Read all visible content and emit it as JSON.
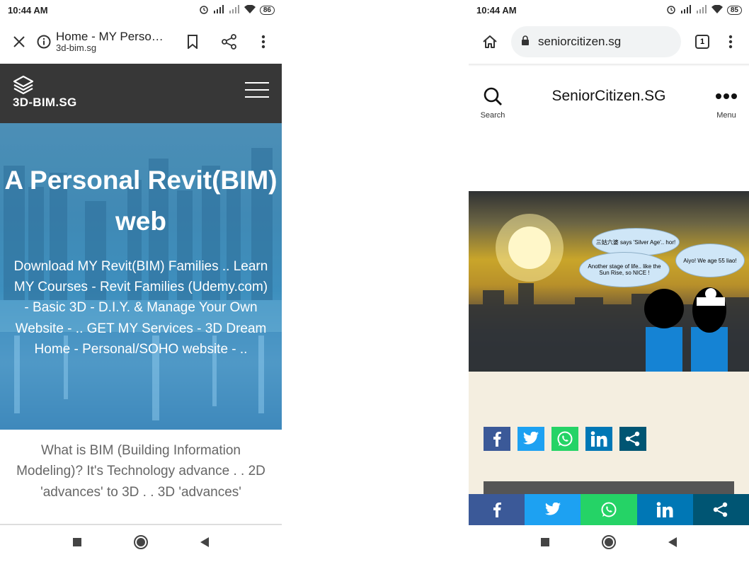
{
  "left_phone": {
    "status": {
      "time": "10:44 AM",
      "battery": "86"
    },
    "toolbar": {
      "page_title": "Home - MY Perso…",
      "domain": "3d-bim.sg"
    },
    "site": {
      "logo": "3D-BIM.SG",
      "hero_heading": "A Personal Revit(BIM) web",
      "hero_text": "Download MY Revit(BIM) Families .. Learn MY Courses - Revit Families (Udemy.com) - Basic 3D - D.I.Y. & Manage Your Own Website - .. GET MY Services - 3D Dream Home - Personal/SOHO website - ..",
      "body_text": "What is BIM (Building Information Modeling)?   It's Technology advance . . 2D 'advances' to 3D . .  3D 'advances'"
    }
  },
  "right_phone": {
    "status": {
      "time": "10:44 AM",
      "battery": "85"
    },
    "toolbar": {
      "url": "seniorcitizen.sg",
      "tab_count": "1"
    },
    "site": {
      "search_label": "Search",
      "title": "SeniorCitizen.SG",
      "menu_label": "Menu",
      "cartoon": {
        "cloud1": "三姑六婆 says 'Silver Age'.. hor!",
        "cloud2": "Another stage of life.. like the Sun Rise, so NICE !",
        "cloud3": "Aiyo! We age 55 liao!"
      },
      "share_buttons": [
        "facebook",
        "twitter",
        "whatsapp",
        "linkedin",
        "share"
      ],
      "colors": {
        "facebook": "#3b5998",
        "twitter": "#1da1f2",
        "whatsapp": "#25d366",
        "linkedin": "#0077b5",
        "share": "#005573",
        "beige": "#f4eee0"
      }
    }
  }
}
